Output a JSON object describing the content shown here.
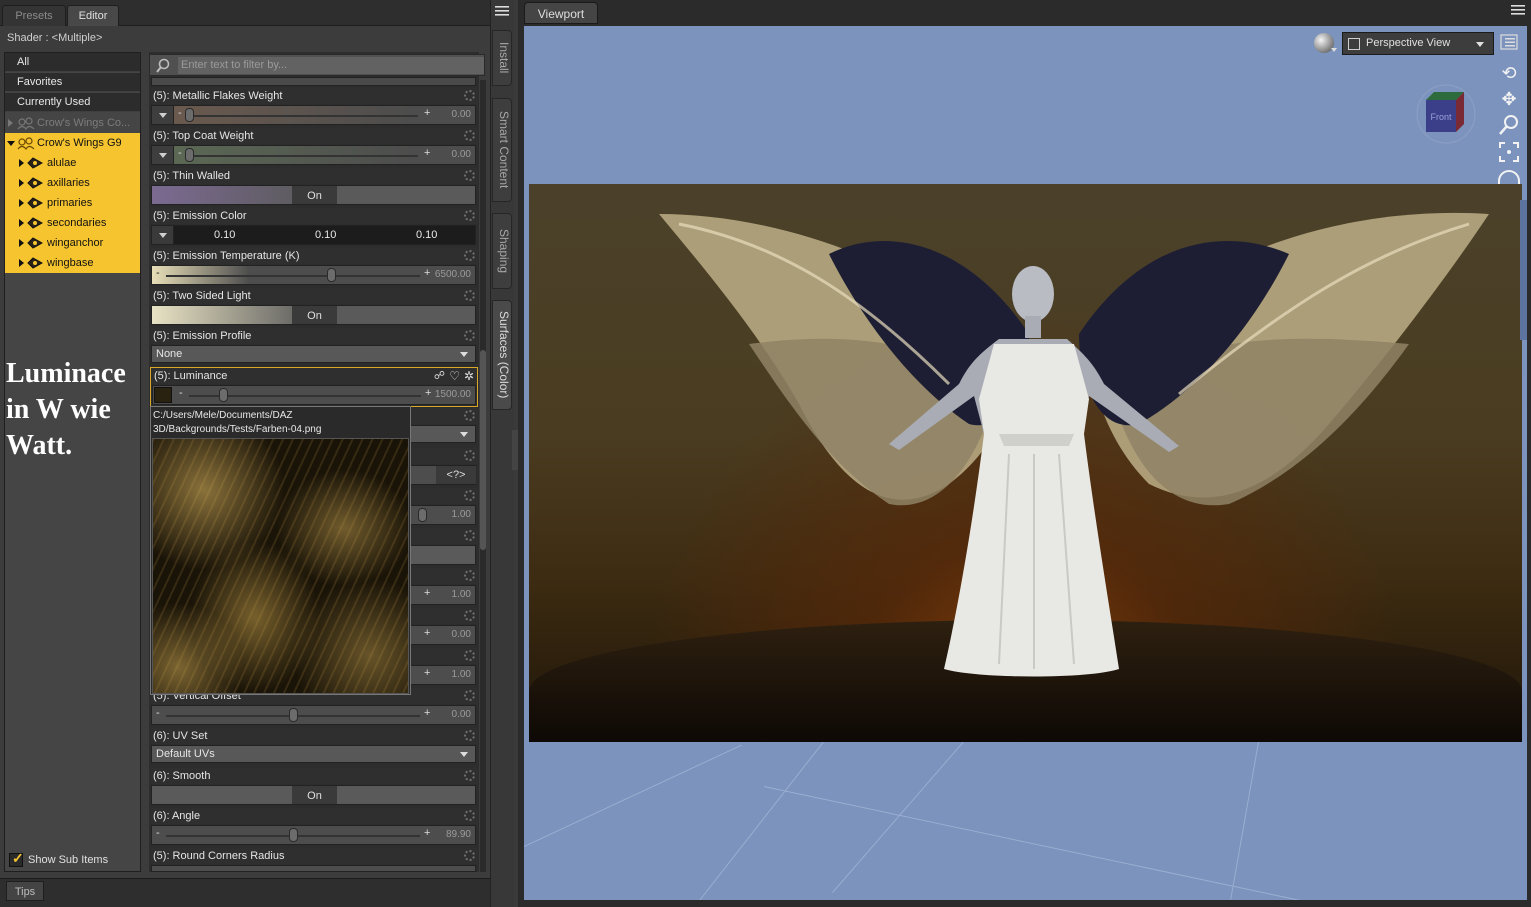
{
  "left_panel": {
    "tabs": [
      {
        "label": "Presets",
        "active": false
      },
      {
        "label": "Editor",
        "active": true
      }
    ],
    "shader_label": "Shader : <Multiple>",
    "categories": [
      "All",
      "Favorites",
      "Currently Used"
    ],
    "tree": [
      {
        "label": "Crow's Wings Co...",
        "expanded": false,
        "selected": false,
        "dim": true,
        "level": 0
      },
      {
        "label": "Crow's Wings G9",
        "expanded": true,
        "selected": true,
        "dim": false,
        "level": 0
      },
      {
        "label": "alulae",
        "level": 1,
        "selected": true
      },
      {
        "label": "axillaries",
        "level": 1,
        "selected": true
      },
      {
        "label": "primaries",
        "level": 1,
        "selected": true
      },
      {
        "label": "secondaries",
        "level": 1,
        "selected": true
      },
      {
        "label": "winganchor",
        "level": 1,
        "selected": true
      },
      {
        "label": "wingbase",
        "level": 1,
        "selected": true
      }
    ],
    "annotation": "Luminace in W wie Watt.",
    "show_sub_items": {
      "label": "Show Sub Items",
      "checked": true
    },
    "filter_placeholder": "Enter text to filter by...",
    "properties": {
      "metallic_flakes_weight": {
        "label": "(5): Metallic Flakes Weight",
        "value": "0.00"
      },
      "top_coat_weight": {
        "label": "(5): Top Coat Weight",
        "value": "0.00"
      },
      "thin_walled": {
        "label": "(5): Thin Walled",
        "state": "On"
      },
      "emission_color": {
        "label": "(5): Emission Color",
        "r": "0.10",
        "g": "0.10",
        "b": "0.10"
      },
      "emission_temperature": {
        "label": "(5): Emission Temperature (K)",
        "value": "6500.00"
      },
      "two_sided_light": {
        "label": "(5): Two Sided Light",
        "state": "On"
      },
      "emission_profile": {
        "label": "(5): Emission Profile",
        "value": "None"
      },
      "luminance": {
        "label": "(5): Luminance",
        "value": "1500.00"
      },
      "hidden_rows": [
        "<?>",
        "1.00",
        "1.00",
        "0.00",
        "1.00"
      ],
      "vertical_offset": {
        "label": "(5): Vertical Offset",
        "value": "0.00"
      },
      "uv_set": {
        "label": "(6): UV Set",
        "value": "Default UVs"
      },
      "smooth": {
        "label": "(6): Smooth",
        "state": "On"
      },
      "angle": {
        "label": "(6): Angle",
        "value": "89.90"
      },
      "round_corners_radius": {
        "label": "(5): Round Corners Radius"
      }
    },
    "tooltip_path": "C:/Users/Mele/Documents/DAZ 3D/Backgrounds/Tests/Farben-04.png",
    "side_tabs": [
      "Install",
      "Smart Content",
      "Shaping",
      "Surfaces (Color)"
    ],
    "tips_tab": "Tips"
  },
  "viewport": {
    "tab_label": "Viewport",
    "camera_label": "Perspective View",
    "cube_label": "Front",
    "canvas_color": "#7b93bd"
  }
}
